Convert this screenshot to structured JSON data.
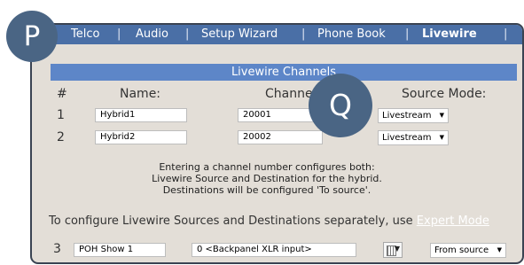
{
  "nav": {
    "items": [
      "Telco",
      "Audio",
      "Setup Wizard",
      "Phone Book",
      "Livewire"
    ],
    "separator": "|",
    "active": "Livewire"
  },
  "section": {
    "title": "Livewire Channels"
  },
  "table": {
    "headers": {
      "num": "#",
      "name": "Name:",
      "channel": "Channel",
      "mode": "Source Mode:"
    },
    "rows": [
      {
        "num": "1",
        "name": "Hybrid1",
        "channel": "20001",
        "mode": "Livestream"
      },
      {
        "num": "2",
        "name": "Hybrid2",
        "channel": "20002",
        "mode": "Livestream"
      }
    ]
  },
  "info": {
    "line1": "Entering a channel number configures both:",
    "line2": "Livewire Source and Destination for the hybrid.",
    "line3": "Destinations will be configured 'To source'."
  },
  "config": {
    "text": "To configure Livewire Sources and Destinations separately, use",
    "link": "Expert Mode"
  },
  "expert_row": {
    "num": "3",
    "name": "POH Show 1",
    "channel": "0 <Backpanel XLR input>",
    "mode": "From source"
  },
  "overlay": {
    "p_label": "P",
    "q_label": "Q"
  },
  "icons": {
    "dropdown": "caret-down-icon",
    "channel_browser": "channel-browser-icon"
  },
  "colors": {
    "nav_bar": "#4a6fa6",
    "section_header": "#5d86c8",
    "panel": "#e3ded7",
    "bubble": "#4a6584"
  }
}
